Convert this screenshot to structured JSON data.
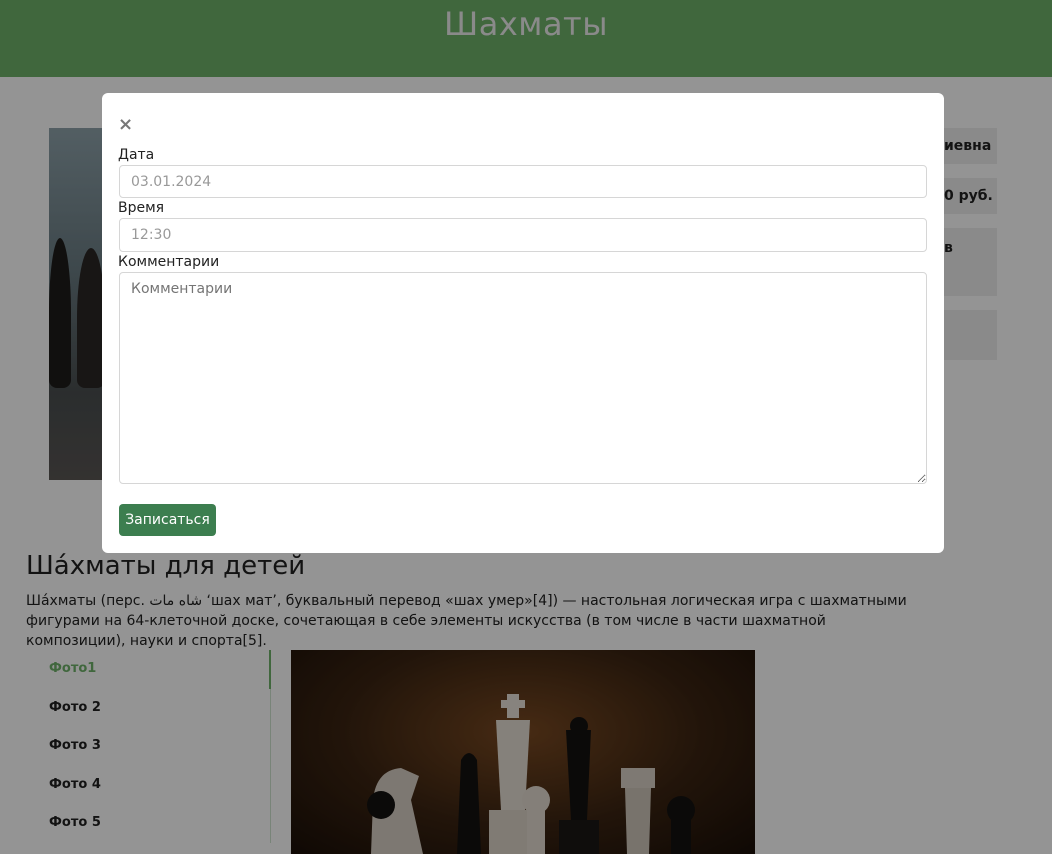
{
  "header": {
    "title": "Шахматы"
  },
  "info_boxes": [
    {
      "text": "иевна"
    },
    {
      "text": "0 руб."
    },
    {
      "text": "в"
    },
    {
      "text": ""
    }
  ],
  "section": {
    "title": "Ша́хматы для детей",
    "description": "Ша́хматы (перс. شاه مات ‘шах мат’, буквальный перевод «шах умер»[4]) — настольная логическая игра с шахматными фигурами на 64-клеточной доске, сочетающая в себе элементы искусства (в том числе в части шахматной композиции), науки и спорта[5]."
  },
  "photo_nav": {
    "active_index": 0,
    "items": [
      "Фото1",
      "Фото 2",
      "Фото 3",
      "Фото 4",
      "Фото 5"
    ]
  },
  "modal": {
    "close_icon": "×",
    "date": {
      "label": "Дата",
      "value": "03.01.2024"
    },
    "time": {
      "label": "Время",
      "value": "12:30"
    },
    "comments": {
      "label": "Комментарии",
      "placeholder": "Комментарии"
    },
    "submit_label": "Записаться"
  },
  "colors": {
    "header_green": "#6eb26a",
    "button_green": "#3c7e4f",
    "active_link": "#6eb26a"
  }
}
